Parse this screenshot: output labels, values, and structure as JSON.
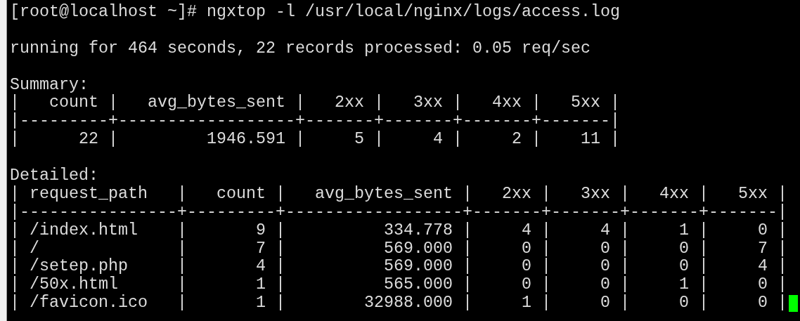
{
  "terminal": {
    "lines": [
      {
        "kind": "text",
        "text": "[root@localhost ~]# ngxtop -l /usr/local/nginx/logs/access.log"
      },
      {
        "kind": "blank"
      },
      {
        "kind": "text",
        "text": "running for 464 seconds, 22 records processed: 0.05 req/sec"
      },
      {
        "kind": "blank"
      },
      {
        "kind": "text",
        "text": "Summary:"
      },
      {
        "kind": "text",
        "text": "|   count |   avg_bytes_sent |   2xx |   3xx |   4xx |   5xx |"
      },
      {
        "kind": "text",
        "text": "|---------+------------------+-------+-------+-------+-------|"
      },
      {
        "kind": "text",
        "text": "|      22 |         1946.591 |     5 |     4 |     2 |    11 |"
      },
      {
        "kind": "blank"
      },
      {
        "kind": "text",
        "text": "Detailed:"
      },
      {
        "kind": "text",
        "text": "| request_path   |   count |   avg_bytes_sent |   2xx |   3xx |   4xx |   5xx |"
      },
      {
        "kind": "text",
        "text": "|----------------+---------+------------------+-------+-------+-------+-------|"
      },
      {
        "kind": "text",
        "text": "| /index.html    |       9 |          334.778 |     4 |     4 |     1 |     0 |"
      },
      {
        "kind": "text",
        "text": "| /              |       7 |          569.000 |     0 |     0 |     0 |     7 |"
      },
      {
        "kind": "text",
        "text": "| /setep.php     |       4 |          569.000 |     0 |     0 |     0 |     4 |"
      },
      {
        "kind": "text",
        "text": "| /50x.html      |       1 |          565.000 |     0 |     0 |     1 |     0 |"
      },
      {
        "kind": "text",
        "text": "| /favicon.ico   |       1 |        32988.000 |     1 |     0 |     0 |     0 |"
      }
    ],
    "cursor": {
      "visible": true
    }
  }
}
